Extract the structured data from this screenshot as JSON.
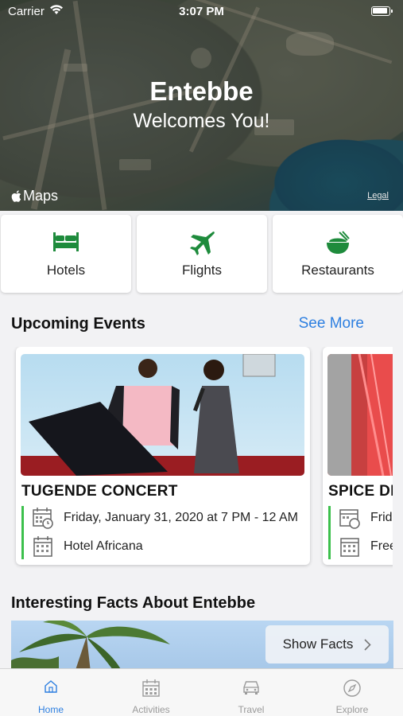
{
  "status_bar": {
    "carrier": "Carrier",
    "time": "3:07 PM"
  },
  "hero": {
    "title": "Entebbe",
    "subtitle": "Welcomes You!",
    "maps_label": "Maps",
    "legal_label": "Legal"
  },
  "categories": [
    {
      "label": "Hotels",
      "icon": "bed-icon"
    },
    {
      "label": "Flights",
      "icon": "airplane-icon"
    },
    {
      "label": "Restaurants",
      "icon": "rice-bowl-icon"
    }
  ],
  "events_section": {
    "title": "Upcoming Events",
    "see_more": "See More"
  },
  "events": [
    {
      "title": "TUGENDE CONCERT",
      "date": "Friday, January 31, 2020 at 7 PM - 12 AM",
      "venue": "Hotel Africana"
    },
    {
      "title": "SPICE DI",
      "date": "Frid",
      "venue": "Free"
    }
  ],
  "facts_section": {
    "title": "Interesting Facts About Entebbe",
    "button": "Show Facts"
  },
  "tabs": [
    {
      "label": "Home",
      "icon": "home-icon",
      "active": true
    },
    {
      "label": "Activities",
      "icon": "calendar-icon",
      "active": false
    },
    {
      "label": "Travel",
      "icon": "car-icon",
      "active": false
    },
    {
      "label": "Explore",
      "icon": "compass-icon",
      "active": false
    }
  ],
  "colors": {
    "accent_green": "#1e8b3c",
    "link_blue": "#2d7fe0",
    "event_bar": "#3cc04c"
  }
}
